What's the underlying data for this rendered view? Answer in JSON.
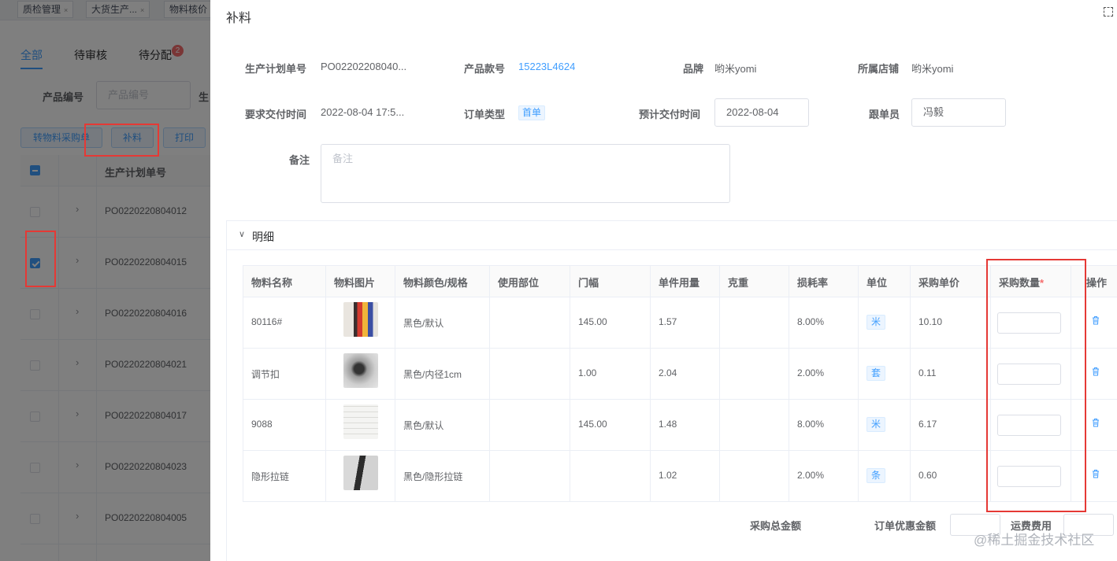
{
  "page_tabs": [
    "质检管理",
    "大货生产...",
    "物料核价"
  ],
  "sub_tabs": [
    "全部",
    "待审核",
    "待分配"
  ],
  "sub_tab_badge": "2",
  "filter": {
    "label": "产品编号",
    "placeholder": "产品编号",
    "label2": "生"
  },
  "toolbar": {
    "convert": "转物料采购单",
    "supplement": "补料",
    "print": "打印"
  },
  "list": {
    "header": "生产计划单号",
    "rows": [
      {
        "po": "PO0220220804012",
        "checked": false
      },
      {
        "po": "PO0220220804015",
        "checked": true
      },
      {
        "po": "PO0220220804016",
        "checked": false
      },
      {
        "po": "PO0220220804021",
        "checked": false
      },
      {
        "po": "PO0220220804017",
        "checked": false
      },
      {
        "po": "PO0220220804023",
        "checked": false
      },
      {
        "po": "PO0220220804005",
        "checked": false
      }
    ]
  },
  "drawer": {
    "title": "补料",
    "fields": {
      "plan_no_label": "生产计划单号",
      "plan_no": "PO02202208040...",
      "style_label": "产品款号",
      "style": "15223L4624",
      "brand_label": "品牌",
      "brand": "哟米yomi",
      "store_label": "所属店铺",
      "store": "哟米yomi",
      "req_date_label": "要求交付时间",
      "req_date": "2022-08-04 17:5...",
      "order_type_label": "订单类型",
      "order_type": "首单",
      "est_date_label": "预计交付时间",
      "est_date": "2022-08-04",
      "follower_label": "跟单员",
      "follower": "冯毅",
      "remark_label": "备注",
      "remark_placeholder": "备注"
    },
    "section_title": "明细",
    "table": {
      "headers": [
        "物料名称",
        "物料图片",
        "物料颜色/规格",
        "使用部位",
        "门幅",
        "单件用量",
        "克重",
        "损耗率",
        "单位",
        "采购单价",
        "采购数量",
        "操作"
      ],
      "rows": [
        {
          "name": "80116#",
          "color": "黑色/默认",
          "part": "",
          "width": "145.00",
          "usage": "1.57",
          "weight": "",
          "loss": "8.00%",
          "unit": "米",
          "price": "10.10"
        },
        {
          "name": "调节扣",
          "color": "黑色/内径1cm",
          "part": "",
          "width": "1.00",
          "usage": "2.04",
          "weight": "",
          "loss": "2.00%",
          "unit": "套",
          "price": "0.11"
        },
        {
          "name": "9088",
          "color": "黑色/默认",
          "part": "",
          "width": "145.00",
          "usage": "1.48",
          "weight": "",
          "loss": "8.00%",
          "unit": "米",
          "price": "6.17"
        },
        {
          "name": "隐形拉链",
          "color": "黑色/隐形拉链",
          "part": "",
          "width": "",
          "usage": "1.02",
          "weight": "",
          "loss": "2.00%",
          "unit": "条",
          "price": "0.60"
        }
      ]
    },
    "footer": {
      "total": "采购总金额",
      "discount": "订单优惠金额",
      "shipping": "运费费用"
    }
  },
  "watermark": "@稀土掘金技术社区",
  "colors": {
    "primary": "#409eff",
    "highlight": "#e53935",
    "danger": "#f56c6c"
  }
}
